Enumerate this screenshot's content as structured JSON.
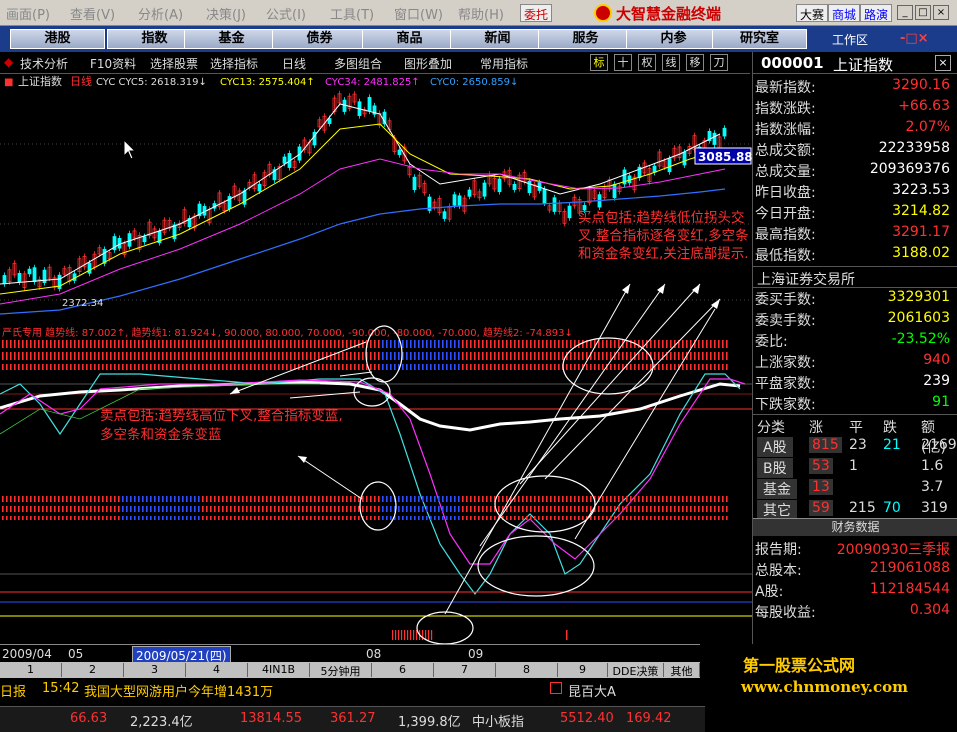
{
  "menu": [
    "画面(P)",
    "查看(V)",
    "分析(A)",
    "决策(J)",
    "公式(I)",
    "工具(T)",
    "窗口(W)",
    "帮助(H)"
  ],
  "brand": {
    "title": "大智慧金融终端",
    "entrust": "委托"
  },
  "top_right": [
    "大赛",
    "商城",
    "路演"
  ],
  "nav": [
    "港股",
    "指数",
    "基金",
    "债券",
    "商品",
    "新闻",
    "服务",
    "内参",
    "研究室"
  ],
  "workspace": "工作区",
  "toolbar": [
    "技术分析",
    "F10资料",
    "选择股票",
    "选择指标",
    "日线",
    "多图组合",
    "图形叠加",
    "常用指标"
  ],
  "tool_icons": [
    "标",
    "十",
    "权",
    "线",
    "移",
    "刀"
  ],
  "stock": {
    "code": "000001",
    "name": "上证指数"
  },
  "chart_header": {
    "name": "上证指数",
    "period": "日线",
    "cyc": "CYC CYC5: 2618.319↓",
    "cyc13": "CYC13: 2575.404↑",
    "cyc34": "CYC34: 2481.825↑",
    "cyc0": "CYC0: 2650.859↓"
  },
  "price_tag": "3085.88",
  "low_label": "2372.34",
  "indicator_header": "严氏专用 趋势线: 87.002↑, 趋势线1: 81.924↓, 90.000, 80.000, 70.000, -90.000, -80.000, -70.000, 趋势线2: -74.893↓",
  "annotation_buy": "买点包括:趋势线低位拐头交叉,整合指标逐各变红,多空条和资金条变红,关注底部提示.",
  "annotation_sell": "卖点包括:趋势线高位下叉,整合指标变蓝,多空条和资金条变蓝",
  "right_panel": {
    "rows": [
      {
        "label": "最新指数:",
        "value": "3290.16",
        "color": "#ff3030"
      },
      {
        "label": "指数涨跌:",
        "value": "+66.63",
        "color": "#ff3030"
      },
      {
        "label": "指数涨幅:",
        "value": "2.07%",
        "color": "#ff3030"
      },
      {
        "label": "总成交额:",
        "value": "22233958",
        "color": "#ffffff"
      },
      {
        "label": "总成交量:",
        "value": "209369376",
        "color": "#ffffff"
      },
      {
        "label": "昨日收盘:",
        "value": "3223.53",
        "color": "#ffffff"
      },
      {
        "label": "今日开盘:",
        "value": "3214.82",
        "color": "#ffff00"
      },
      {
        "label": "最高指数:",
        "value": "3291.17",
        "color": "#ff3030"
      },
      {
        "label": "最低指数:",
        "value": "3188.02",
        "color": "#ffff00"
      }
    ],
    "exchange": "上海证券交易所",
    "rows2": [
      {
        "label": "委买手数:",
        "value": "3329301",
        "color": "#ffff00"
      },
      {
        "label": "委卖手数:",
        "value": "2061603",
        "color": "#ffff00"
      },
      {
        "label": "委比:",
        "value": "-23.52%",
        "color": "#00ff00"
      },
      {
        "label": "上涨家数:",
        "value": "940",
        "color": "#ff3030"
      },
      {
        "label": "平盘家数:",
        "value": "239",
        "color": "#ffffff"
      },
      {
        "label": "下跌家数:",
        "value": "91",
        "color": "#00ff00"
      }
    ],
    "table_head": [
      "分类",
      "涨",
      "平",
      "跌",
      "额(亿)"
    ],
    "table": [
      [
        "A股",
        "815",
        "23",
        "21",
        "2169"
      ],
      [
        "B股",
        "53",
        "1",
        "",
        "1.6"
      ],
      [
        "基金",
        "13",
        "",
        "",
        "3.7"
      ],
      [
        "其它",
        "59",
        "215",
        "70",
        "319"
      ]
    ],
    "fin_title": "财务数据",
    "fin": [
      {
        "label": "报告期:",
        "value": "20090930三季报",
        "color": "#ff3030"
      },
      {
        "label": "总股本:",
        "value": "219061088",
        "color": "#ff3030"
      },
      {
        "label": "A股:",
        "value": "112184544",
        "color": "#ff3030"
      },
      {
        "label": "每股收益:",
        "value": "0.304",
        "color": "#ff3030"
      }
    ]
  },
  "timebar": {
    "start": "2009/04",
    "m05": "05",
    "cursor": "2009/05/21(四)",
    "m08": "08",
    "m09": "09"
  },
  "tabs": [
    "1",
    "2",
    "3",
    "4",
    "4IN1B",
    "5分钟用",
    "6",
    "7",
    "8",
    "9",
    "DDE决策",
    "其他"
  ],
  "news": {
    "left": "日报",
    "time": "15:42",
    "text": "我国大型网游用户今年增1431万",
    "right": "昆百大A"
  },
  "status": {
    "a": "66.63",
    "b": "2,223.4亿",
    "c": "13814.55",
    "d": "361.27",
    "e": "1,399.8亿",
    "f": "中小板指",
    "g": "5512.40",
    "h": "169.42"
  },
  "watermark": {
    "name": "第一股票公式网",
    "url": "www.chnmoney.com"
  },
  "colors": {
    "up": "#ff3030",
    "down": "#00ffff",
    "accent": "#ffff00"
  }
}
